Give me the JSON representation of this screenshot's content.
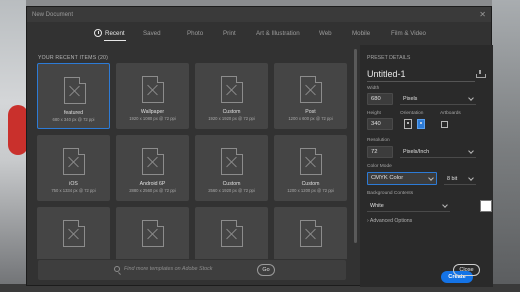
{
  "window": {
    "title": "New Document",
    "close_glyph": "✕"
  },
  "tabs": [
    {
      "label": "Recent",
      "active": true
    },
    {
      "label": "Saved"
    },
    {
      "label": "Photo"
    },
    {
      "label": "Print"
    },
    {
      "label": "Art & Illustration"
    },
    {
      "label": "Web"
    },
    {
      "label": "Mobile"
    },
    {
      "label": "Film & Video"
    }
  ],
  "recent": {
    "heading": "YOUR RECENT ITEMS",
    "count": "(20)",
    "items": [
      {
        "name": "featured",
        "size": "680 x 340 px @ 72 ppi",
        "selected": true
      },
      {
        "name": "Wallpaper",
        "size": "1920 x 1080 px @ 72 ppi"
      },
      {
        "name": "Custom",
        "size": "1920 x 1920 px @ 72 ppi"
      },
      {
        "name": "Post",
        "size": "1200 x 600 px @ 72 ppi"
      },
      {
        "name": "iOS",
        "size": "750 x 1334 px @ 72 ppi"
      },
      {
        "name": "Android 6P",
        "size": "2880 x 2560 px @ 72 ppi"
      },
      {
        "name": "Custom",
        "size": "2560 x 1920 px @ 72 ppi"
      },
      {
        "name": "Custom",
        "size": "1200 x 1200 px @ 72 ppi"
      },
      {
        "name": "",
        "size": ""
      },
      {
        "name": "",
        "size": ""
      },
      {
        "name": "",
        "size": ""
      },
      {
        "name": "",
        "size": ""
      }
    ]
  },
  "search": {
    "placeholder": "Find more templates on Adobe Stock",
    "go_label": "Go",
    "icon": "search-icon"
  },
  "preset": {
    "heading": "PRESET DETAILS",
    "doc_name": "Untitled-1",
    "width_label": "Width",
    "width_value": "680",
    "width_unit": "Pixels",
    "height_label": "Height",
    "height_value": "340",
    "orientation_label": "Orientation",
    "artboards_label": "Artboards",
    "resolution_label": "Resolution",
    "resolution_value": "72",
    "resolution_unit": "Pixels/Inch",
    "color_mode_label": "Color Mode",
    "color_mode_value": "CMYK Color",
    "bit_depth": "8 bit",
    "background_label": "Background Contents",
    "background_value": "White",
    "background_color": "#ffffff",
    "advanced_label": "› Advanced Options"
  },
  "actions": {
    "create_label": "Create",
    "close_label": "Close"
  },
  "colors": {
    "accent": "#1473e6",
    "panel": "#2a2a2a",
    "window": "#323232"
  }
}
